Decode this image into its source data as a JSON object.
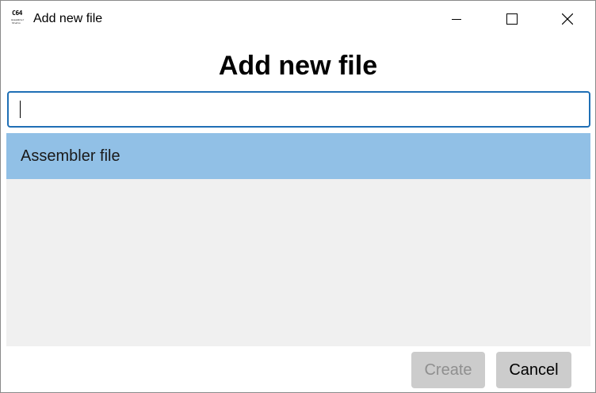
{
  "window": {
    "title": "Add new file",
    "icon": {
      "name": "c64-assembler-studio-icon",
      "line1": "C64",
      "line2": "Assembler",
      "line3": "Studio"
    },
    "controls": {
      "minimize": "minimize-icon",
      "maximize": "maximize-icon",
      "close": "close-icon"
    }
  },
  "dialog": {
    "heading": "Add new file",
    "input": {
      "value": "",
      "placeholder": ""
    },
    "file_types": [
      {
        "label": "Assembler file",
        "selected": true
      }
    ],
    "buttons": {
      "create": "Create",
      "cancel": "Cancel"
    },
    "create_enabled": false
  },
  "colors": {
    "input_border": "#1f6fb5",
    "selection": "#91c0e6",
    "list_background": "#f0f0f0",
    "button_background": "#cccccc",
    "disabled_text": "#8f8f8f"
  }
}
